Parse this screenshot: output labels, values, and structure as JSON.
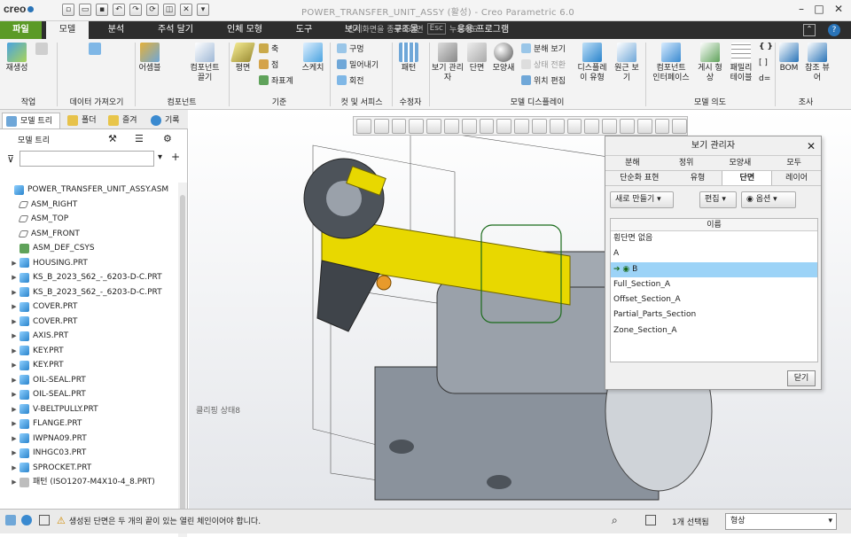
{
  "title_bar": {
    "logo": "creo",
    "title": "POWER_TRANSFER_UNIT_ASSY (활성) - Creo Parametric 6.0",
    "hint": "전체화면을 종료하려면",
    "esc_key": "Esc",
    "hint_tail": "누르세요"
  },
  "ribbon_tabs": [
    "파일",
    "모델",
    "분석",
    "주석 달기",
    "인체 모형",
    "도구",
    "보기",
    "구조물",
    "응용 프로그램"
  ],
  "ribbon": {
    "regen": "재생성",
    "ops": "작업",
    "data_get": "데이터 가져오기",
    "assemble": "어셈블",
    "comp_drag": "컴포넌트\n끌기",
    "components": "컴포넌트",
    "plane": "평면",
    "axis": "축",
    "point": "점",
    "csys": "좌표계",
    "sketch": "스케치",
    "datum": "기준",
    "hole": "구멍",
    "extrude": "밀어내기",
    "revolve": "회전",
    "cut_surface": "컷 및 서피스",
    "pattern": "패턴",
    "modifiers": "수정자",
    "view_mgr": "보기 관리\n자",
    "section": "단면",
    "appearance": "모양새",
    "explode": "분해 보기",
    "state_change": "상태 전환",
    "edit_pos": "위치 편집",
    "display_style": "디스플레\n이 유형",
    "persp": "원근 보\n기",
    "model_display": "모델 디스플레이",
    "comp_if": "컴포넌트\n인터페이스",
    "bulletin": "게시 형\n상",
    "family": "패밀리\n테이블",
    "model_intent": "모델 의도",
    "bom": "BOM",
    "ref_viewer": "참조 뷰\n어",
    "investigate": "조사"
  },
  "side_tabs": [
    "모델 트리",
    "폴더",
    "즐겨",
    "기록"
  ],
  "panel_header": "모델 트리",
  "tree": [
    {
      "label": "POWER_TRANSFER_UNIT_ASSY.ASM",
      "icon": "assembly",
      "arrow": false,
      "indent": 0
    },
    {
      "label": "ASM_RIGHT",
      "icon": "plane",
      "arrow": false,
      "indent": 1
    },
    {
      "label": "ASM_TOP",
      "icon": "plane",
      "arrow": false,
      "indent": 1
    },
    {
      "label": "ASM_FRONT",
      "icon": "plane",
      "arrow": false,
      "indent": 1
    },
    {
      "label": "ASM_DEF_CSYS",
      "icon": "csys",
      "arrow": false,
      "indent": 1
    },
    {
      "label": "HOUSING.PRT",
      "icon": "part",
      "arrow": true,
      "indent": 1
    },
    {
      "label": "KS_B_2023_S62_-_6203-D-C.PRT",
      "icon": "part",
      "arrow": true,
      "indent": 1
    },
    {
      "label": "KS_B_2023_S62_-_6203-D-C.PRT",
      "icon": "part",
      "arrow": true,
      "indent": 1
    },
    {
      "label": "COVER.PRT",
      "icon": "part",
      "arrow": true,
      "indent": 1
    },
    {
      "label": "COVER.PRT",
      "icon": "part",
      "arrow": true,
      "indent": 1
    },
    {
      "label": "AXIS.PRT",
      "icon": "part",
      "arrow": true,
      "indent": 1
    },
    {
      "label": "KEY.PRT",
      "icon": "part",
      "arrow": true,
      "indent": 1
    },
    {
      "label": "KEY.PRT",
      "icon": "part",
      "arrow": true,
      "indent": 1
    },
    {
      "label": "OIL-SEAL.PRT",
      "icon": "part",
      "arrow": true,
      "indent": 1
    },
    {
      "label": "OIL-SEAL.PRT",
      "icon": "part",
      "arrow": true,
      "indent": 1
    },
    {
      "label": "V-BELTPULLY.PRT",
      "icon": "part",
      "arrow": true,
      "indent": 1
    },
    {
      "label": "FLANGE.PRT",
      "icon": "part",
      "arrow": true,
      "indent": 1
    },
    {
      "label": "IWPNA09.PRT",
      "icon": "part",
      "arrow": true,
      "indent": 1
    },
    {
      "label": "INHGC03.PRT",
      "icon": "part",
      "arrow": true,
      "indent": 1
    },
    {
      "label": "SPROCKET.PRT",
      "icon": "part",
      "arrow": true,
      "indent": 1
    },
    {
      "label": "패턴 (ISO1207-M4X10-4_8.PRT)",
      "icon": "pattern",
      "arrow": true,
      "indent": 1
    }
  ],
  "viewport_label": "클리핑 상태8",
  "view_manager": {
    "title": "보기 관리자",
    "tabs_row1": [
      "분해",
      "정위",
      "모양새",
      "모두"
    ],
    "tabs_row2": [
      "단순화 표현",
      "유형",
      "단면",
      "레이어"
    ],
    "active_tab": "단면",
    "new_btn": "새로 만들기",
    "edit_btn": "편집",
    "options_btn": "옵션",
    "list_header": "이름",
    "items": [
      "횡단면 없음",
      "A",
      "B",
      "Full_Section_A",
      "Offset_Section_A",
      "Partial_Parts_Section",
      "Zone_Section_A"
    ],
    "selected_index": 2,
    "close_btn": "닫기"
  },
  "status": {
    "message": "생성된 단면은 두 개의 끝이 있는 열린 체인이어야 합니다.",
    "selected": "1개 선택됨",
    "filter": "형상"
  },
  "colors": {
    "file_tab": "#5b9a26",
    "ribbon_bar": "#2d2d2d",
    "shaft": "#e8d800",
    "housing": "#8a929c",
    "selection": "#9cd3f7"
  }
}
